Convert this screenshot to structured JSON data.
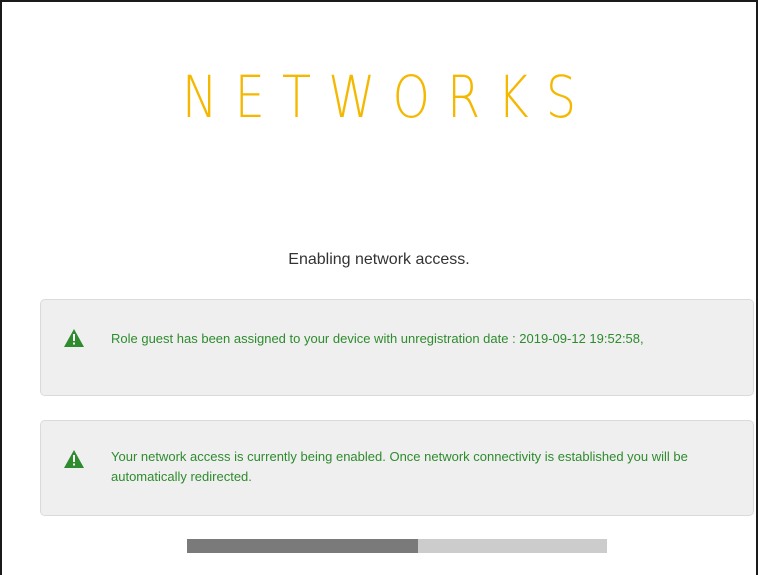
{
  "logo": {
    "text": "NETWORKS"
  },
  "status": {
    "heading": "Enabling network access."
  },
  "alerts": [
    {
      "icon": "warning-triangle-icon",
      "message": "Role guest has been assigned to your device with unregistration date : 2019-09-12 19:52:58,"
    },
    {
      "icon": "warning-triangle-icon",
      "message": "Your network access is currently being enabled. Once network connectivity is established you will be automatically redirected."
    }
  ],
  "progress": {
    "fraction": 0.55
  },
  "colors": {
    "logo": "#f5b800",
    "alert_text": "#2e8b2e",
    "alert_icon": "#2e8b2e",
    "alert_bg": "#efefef",
    "progress_track": "#cccccc",
    "progress_fill": "#7a7a7a"
  }
}
